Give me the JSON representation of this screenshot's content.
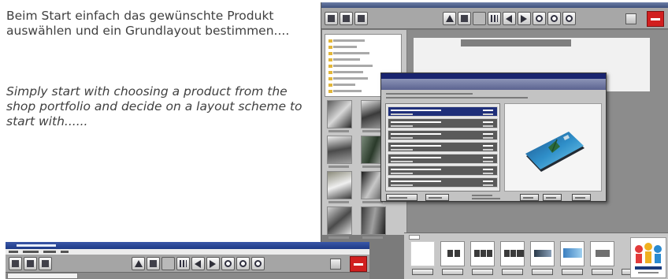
{
  "caption": {
    "german": "Beim Start einfach das gewünschte Produkt auswählen und ein Grundlayout bestimmen....",
    "english": "Simply start with choosing a product from the shop portfolio and decide on a layout scheme to start with......"
  },
  "colors": {
    "caption_text": "#404040",
    "dialog_header": "#5b6390",
    "selected_row": "#1f2f7a",
    "logo_red": "#d11f1f",
    "window_bg": "#7b7b7b"
  },
  "icons": [
    "home-icon",
    "open-icon",
    "save-icon",
    "pointer-icon",
    "image-icon",
    "grid-icon",
    "arrow-left-icon",
    "arrow-right-icon",
    "zoom-in-icon",
    "zoom-out-icon",
    "zoom-fit-icon",
    "cart-icon",
    "brand-logo-icon"
  ]
}
